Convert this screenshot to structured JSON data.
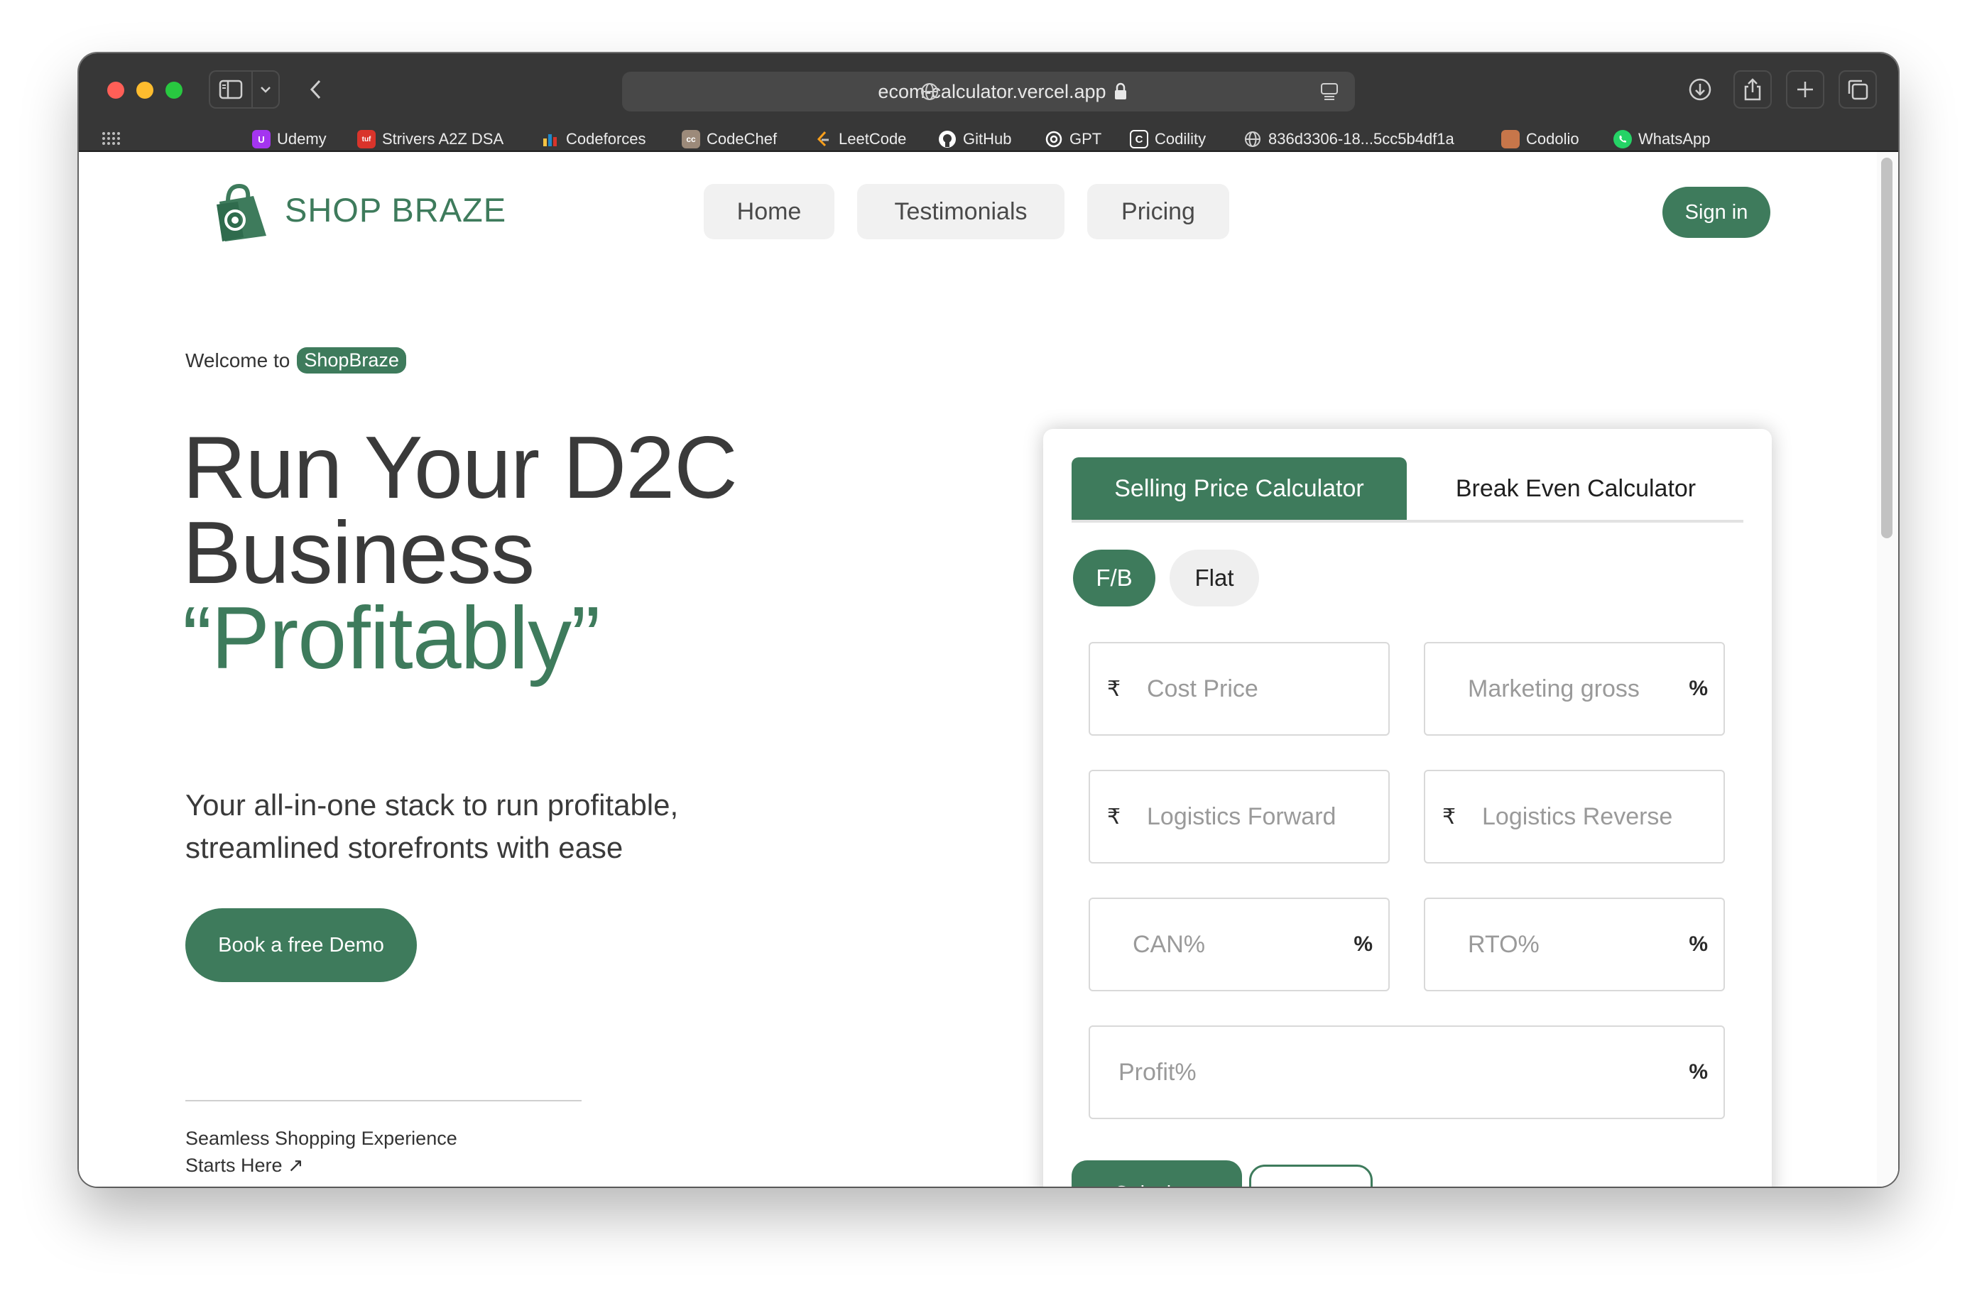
{
  "browser": {
    "url": "ecom-calculator.vercel.app",
    "bookmarks": [
      {
        "label": "Udemy",
        "icon": "udemy-icon",
        "color": "#a435f0",
        "glyph": "U"
      },
      {
        "label": "Strivers A2Z DSA",
        "icon": "tuf-icon",
        "color": "#d9342b",
        "glyph": "tuf"
      },
      {
        "label": "Codeforces",
        "icon": "codeforces-icon",
        "color": "#1f8acb",
        "glyph": "▮"
      },
      {
        "label": "CodeChef",
        "icon": "codechef-icon",
        "color": "#5b4638",
        "glyph": "cc"
      },
      {
        "label": "LeetCode",
        "icon": "leetcode-icon",
        "color": "#f89f1b",
        "glyph": "◆"
      },
      {
        "label": "GitHub",
        "icon": "github-icon",
        "color": "#ffffff",
        "glyph": "●"
      },
      {
        "label": "GPT",
        "icon": "openai-icon",
        "color": "#ffffff",
        "glyph": "✿"
      },
      {
        "label": "Codility",
        "icon": "codility-icon",
        "color": "#ffffff",
        "glyph": "C"
      },
      {
        "label": "836d3306-18...5cc5b4df1a",
        "icon": "globe-icon",
        "color": "#cfcfcf",
        "glyph": "⊕"
      },
      {
        "label": "Codolio",
        "icon": "codolio-icon",
        "color": "#c7764a",
        "glyph": "■"
      },
      {
        "label": "WhatsApp",
        "icon": "whatsapp-icon",
        "color": "#25d366",
        "glyph": "✆"
      }
    ]
  },
  "header": {
    "brand": "SHOP BRAZE",
    "nav": [
      "Home",
      "Testimonials",
      "Pricing"
    ],
    "signin": "Sign in"
  },
  "hero": {
    "welcome": "Welcome to",
    "badge": "ShopBraze",
    "line1": "Run Your D2C",
    "line2": "Business",
    "line3": "“Profitably”",
    "subtitle_line1": "Your all-in-one stack to run profitable,",
    "subtitle_line2": "streamlined storefronts with ease",
    "cta": "Book a free Demo",
    "footer_line1": "Seamless Shopping Experience",
    "footer_line2": "Starts Here ↗"
  },
  "calculator": {
    "tabs": [
      "Selling Price Calculator",
      "Break Even Calculator"
    ],
    "toggles": [
      "F/B",
      "Flat"
    ],
    "fields": {
      "cost_price": {
        "placeholder": "Cost Price",
        "prefix": "₹"
      },
      "marketing_gross": {
        "placeholder": "Marketing gross",
        "suffix": "%"
      },
      "logistics_forward": {
        "placeholder": "Logistics Forward",
        "prefix": "₹"
      },
      "logistics_reverse": {
        "placeholder": "Logistics Reverse",
        "prefix": "₹"
      },
      "can": {
        "placeholder": "CAN%",
        "suffix": "%"
      },
      "rto": {
        "placeholder": "RTO%",
        "suffix": "%"
      },
      "profit": {
        "placeholder": "Profit%",
        "suffix": "%"
      }
    },
    "calculate": "Calculate",
    "reset": "Reset"
  },
  "colors": {
    "brand_green": "#3e7b5c",
    "browser_chrome": "#373737"
  }
}
